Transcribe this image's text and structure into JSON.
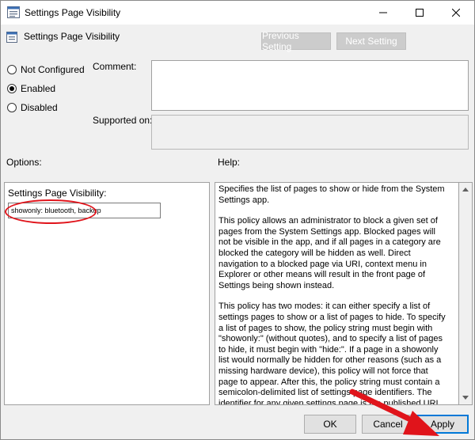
{
  "window": {
    "title": "Settings Page Visibility",
    "minimize_glyph": "—",
    "close_glyph": "✕"
  },
  "header": {
    "policy_title": "Settings Page Visibility",
    "prev_button": "Previous Setting",
    "next_button": "Next Setting"
  },
  "state": {
    "options": [
      {
        "label": "Not Configured",
        "selected": false
      },
      {
        "label": "Enabled",
        "selected": true
      },
      {
        "label": "Disabled",
        "selected": false
      }
    ]
  },
  "fields": {
    "comment_label": "Comment:",
    "supported_label": "Supported on:",
    "comment_value": "",
    "supported_value": ""
  },
  "options_panel": {
    "heading": "Options:",
    "setting_label": "Settings Page Visibility:",
    "setting_value": "showonly: bluetooth, backup"
  },
  "help_panel": {
    "heading": "Help:",
    "paragraphs": [
      "Specifies the list of pages to show or hide from the System Settings app.",
      "This policy allows an administrator to block a given set of pages from the System Settings app. Blocked pages will not be visible in the app, and if all pages in a category are blocked the category will be hidden as well. Direct navigation to a blocked page via URI, context menu in Explorer or other means will result in the front page of Settings being shown instead.",
      "This policy has two modes: it can either specify a list of settings pages to show or a list of pages to hide. To specify a list of pages to show, the policy string must begin with \"showonly:\" (without quotes), and to specify a list of pages to hide, it must begin with \"hide:\". If a page in a showonly list would normally be hidden for other reasons (such as a missing hardware device), this policy will not force that page to appear. After this, the policy string must contain a semicolon-delimited list of settings page identifiers. The identifier for any given settings page is the published URI for that page, minus the \"ms-settings:\" protocol part."
    ]
  },
  "footer": {
    "ok": "OK",
    "cancel": "Cancel",
    "apply": "Apply"
  },
  "colors": {
    "annotation_red": "#e0141b",
    "focus_blue": "#0078d7"
  }
}
